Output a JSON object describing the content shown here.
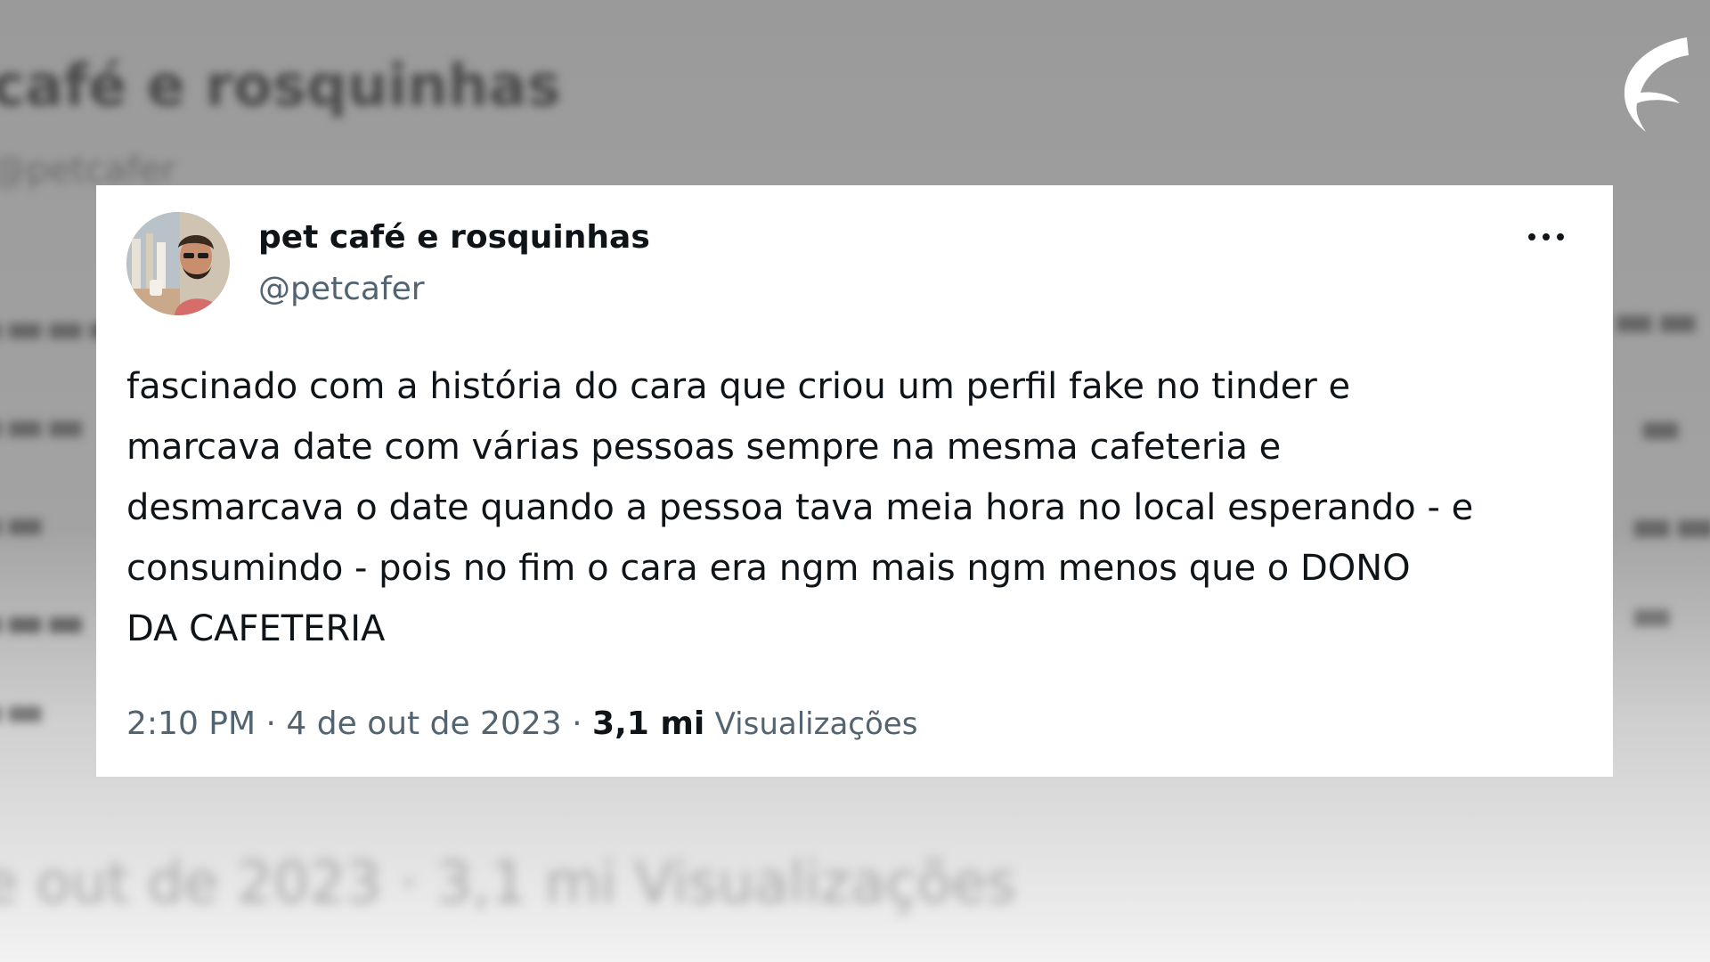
{
  "background": {
    "blurred_title": "café e rosquinhas",
    "blurred_handle": "@petcafer",
    "blurred_footer": "de out de 2023 · 3,1 mi Visualizações",
    "color": "#9a9a9a"
  },
  "logo": {
    "icon": "brand-logo-icon",
    "color": "#ffffff"
  },
  "tweet": {
    "author_name": "pet café e rosquinhas",
    "author_handle": "@petcafer",
    "avatar_icon": "avatar-photo",
    "more_icon": "more-options-icon",
    "text_lines": [
      "fascinado com a história do cara que criou um perfil fake no tinder e",
      "marcava date com várias pessoas sempre na mesma cafeteria e",
      "desmarcava o date quando a pessoa tava meia hora no local esperando - e",
      "consumindo - pois no fim o cara era ngm mais ngm menos que o DONO",
      "DA CAFETERIA"
    ],
    "time": "2:10 PM",
    "separator": "·",
    "date": "4 de out de 2023",
    "views_count": "3,1 mi",
    "views_label": "Visualizações",
    "text_color": "#0f1419",
    "muted_color": "#536471"
  }
}
